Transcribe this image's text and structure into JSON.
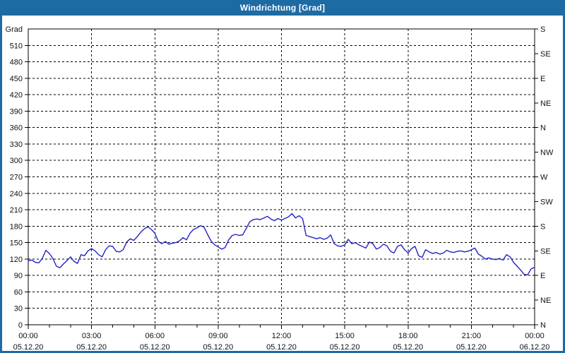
{
  "window": {
    "title": "Windrichtung [Grad]"
  },
  "colors": {
    "titlebar_bg": "#1e6ba3",
    "titlebar_text": "#ffffff",
    "page_border": "#1e6ba3",
    "background": "#ffffff",
    "series_line": "#2323c8",
    "grid_line": "#000000",
    "axis_frame": "#000000",
    "tick_text": "#101018"
  },
  "chart_data": {
    "type": "line",
    "title": "Windrichtung [Grad]",
    "grid": "dashed",
    "legend": "none",
    "y_left": {
      "label": "Grad",
      "min": 0,
      "max": 540,
      "tick_step": 30,
      "ticks": [
        0,
        30,
        60,
        90,
        120,
        150,
        180,
        210,
        240,
        270,
        300,
        330,
        360,
        390,
        420,
        450,
        480,
        510
      ]
    },
    "y_right": {
      "description": "compass directions every 45 Grad",
      "ticks": [
        {
          "value": 540,
          "label": "S"
        },
        {
          "value": 495,
          "label": "SE"
        },
        {
          "value": 450,
          "label": "E"
        },
        {
          "value": 405,
          "label": "NE"
        },
        {
          "value": 360,
          "label": "N"
        },
        {
          "value": 315,
          "label": "NW"
        },
        {
          "value": 270,
          "label": "W"
        },
        {
          "value": 225,
          "label": "SW"
        },
        {
          "value": 180,
          "label": "S"
        },
        {
          "value": 135,
          "label": "SE"
        },
        {
          "value": 90,
          "label": "E"
        },
        {
          "value": 45,
          "label": "NE"
        },
        {
          "value": 0,
          "label": "N"
        }
      ]
    },
    "x": {
      "unit": "time",
      "min_minutes": 0,
      "max_minutes": 1440,
      "minor_tick_minutes": 60,
      "major_ticks": [
        {
          "minutes": 0,
          "time": "00:00",
          "date": "05.12.20"
        },
        {
          "minutes": 180,
          "time": "03:00",
          "date": "05.12.20"
        },
        {
          "minutes": 360,
          "time": "06:00",
          "date": "05.12.20"
        },
        {
          "minutes": 540,
          "time": "09:00",
          "date": "05.12.20"
        },
        {
          "minutes": 720,
          "time": "12:00",
          "date": "05.12.20"
        },
        {
          "minutes": 900,
          "time": "15:00",
          "date": "05.12.20"
        },
        {
          "minutes": 1080,
          "time": "18:00",
          "date": "05.12.20"
        },
        {
          "minutes": 1260,
          "time": "21:00",
          "date": "05.12.20"
        },
        {
          "minutes": 1440,
          "time": "00:00",
          "date": "06.12.20"
        }
      ]
    },
    "series": [
      {
        "name": "Windrichtung",
        "unit": "Grad",
        "points": [
          [
            0,
            117
          ],
          [
            10,
            118
          ],
          [
            20,
            114
          ],
          [
            30,
            113
          ],
          [
            40,
            121
          ],
          [
            50,
            136
          ],
          [
            60,
            130
          ],
          [
            70,
            121
          ],
          [
            80,
            107
          ],
          [
            90,
            104
          ],
          [
            100,
            111
          ],
          [
            110,
            117
          ],
          [
            120,
            124
          ],
          [
            130,
            116
          ],
          [
            140,
            112
          ],
          [
            150,
            128
          ],
          [
            160,
            126
          ],
          [
            170,
            135
          ],
          [
            180,
            139
          ],
          [
            190,
            135
          ],
          [
            200,
            128
          ],
          [
            210,
            124
          ],
          [
            220,
            137
          ],
          [
            230,
            144
          ],
          [
            240,
            143
          ],
          [
            250,
            134
          ],
          [
            260,
            133
          ],
          [
            270,
            137
          ],
          [
            280,
            151
          ],
          [
            290,
            157
          ],
          [
            300,
            154
          ],
          [
            310,
            161
          ],
          [
            320,
            169
          ],
          [
            330,
            175
          ],
          [
            340,
            179
          ],
          [
            350,
            174
          ],
          [
            360,
            167
          ],
          [
            370,
            152
          ],
          [
            380,
            148
          ],
          [
            390,
            152
          ],
          [
            400,
            147
          ],
          [
            410,
            149
          ],
          [
            420,
            150
          ],
          [
            430,
            153
          ],
          [
            440,
            159
          ],
          [
            450,
            155
          ],
          [
            460,
            167
          ],
          [
            470,
            174
          ],
          [
            480,
            177
          ],
          [
            490,
            181
          ],
          [
            500,
            178
          ],
          [
            510,
            165
          ],
          [
            520,
            153
          ],
          [
            530,
            146
          ],
          [
            540,
            142
          ],
          [
            550,
            138
          ],
          [
            560,
            141
          ],
          [
            570,
            155
          ],
          [
            580,
            163
          ],
          [
            590,
            165
          ],
          [
            600,
            163
          ],
          [
            610,
            164
          ],
          [
            620,
            176
          ],
          [
            630,
            188
          ],
          [
            640,
            192
          ],
          [
            650,
            193
          ],
          [
            660,
            192
          ],
          [
            670,
            195
          ],
          [
            680,
            198
          ],
          [
            690,
            193
          ],
          [
            700,
            190
          ],
          [
            710,
            194
          ],
          [
            720,
            191
          ],
          [
            730,
            194
          ],
          [
            740,
            197
          ],
          [
            750,
            203
          ],
          [
            760,
            195
          ],
          [
            770,
            199
          ],
          [
            780,
            194
          ],
          [
            790,
            163
          ],
          [
            800,
            161
          ],
          [
            810,
            159
          ],
          [
            820,
            157
          ],
          [
            830,
            159
          ],
          [
            840,
            156
          ],
          [
            850,
            158
          ],
          [
            860,
            164
          ],
          [
            870,
            148
          ],
          [
            880,
            144
          ],
          [
            890,
            143
          ],
          [
            900,
            146
          ],
          [
            910,
            156
          ],
          [
            920,
            148
          ],
          [
            930,
            150
          ],
          [
            940,
            146
          ],
          [
            950,
            143
          ],
          [
            960,
            140
          ],
          [
            970,
            151
          ],
          [
            980,
            148
          ],
          [
            990,
            138
          ],
          [
            1000,
            141
          ],
          [
            1010,
            147
          ],
          [
            1020,
            144
          ],
          [
            1030,
            134
          ],
          [
            1040,
            131
          ],
          [
            1050,
            143
          ],
          [
            1060,
            146
          ],
          [
            1070,
            137
          ],
          [
            1080,
            131
          ],
          [
            1090,
            139
          ],
          [
            1100,
            143
          ],
          [
            1110,
            126
          ],
          [
            1120,
            123
          ],
          [
            1130,
            137
          ],
          [
            1140,
            133
          ],
          [
            1150,
            130
          ],
          [
            1160,
            132
          ],
          [
            1170,
            129
          ],
          [
            1180,
            131
          ],
          [
            1190,
            136
          ],
          [
            1200,
            133
          ],
          [
            1210,
            132
          ],
          [
            1220,
            134
          ],
          [
            1230,
            135
          ],
          [
            1240,
            133
          ],
          [
            1250,
            134
          ],
          [
            1260,
            137
          ],
          [
            1270,
            140
          ],
          [
            1280,
            129
          ],
          [
            1290,
            125
          ],
          [
            1300,
            120
          ],
          [
            1310,
            122
          ],
          [
            1320,
            120
          ],
          [
            1330,
            119
          ],
          [
            1340,
            121
          ],
          [
            1350,
            118
          ],
          [
            1360,
            128
          ],
          [
            1370,
            124
          ],
          [
            1380,
            114
          ],
          [
            1390,
            107
          ],
          [
            1400,
            100
          ],
          [
            1410,
            92
          ],
          [
            1420,
            91
          ],
          [
            1430,
            102
          ],
          [
            1440,
            105
          ]
        ]
      }
    ]
  }
}
